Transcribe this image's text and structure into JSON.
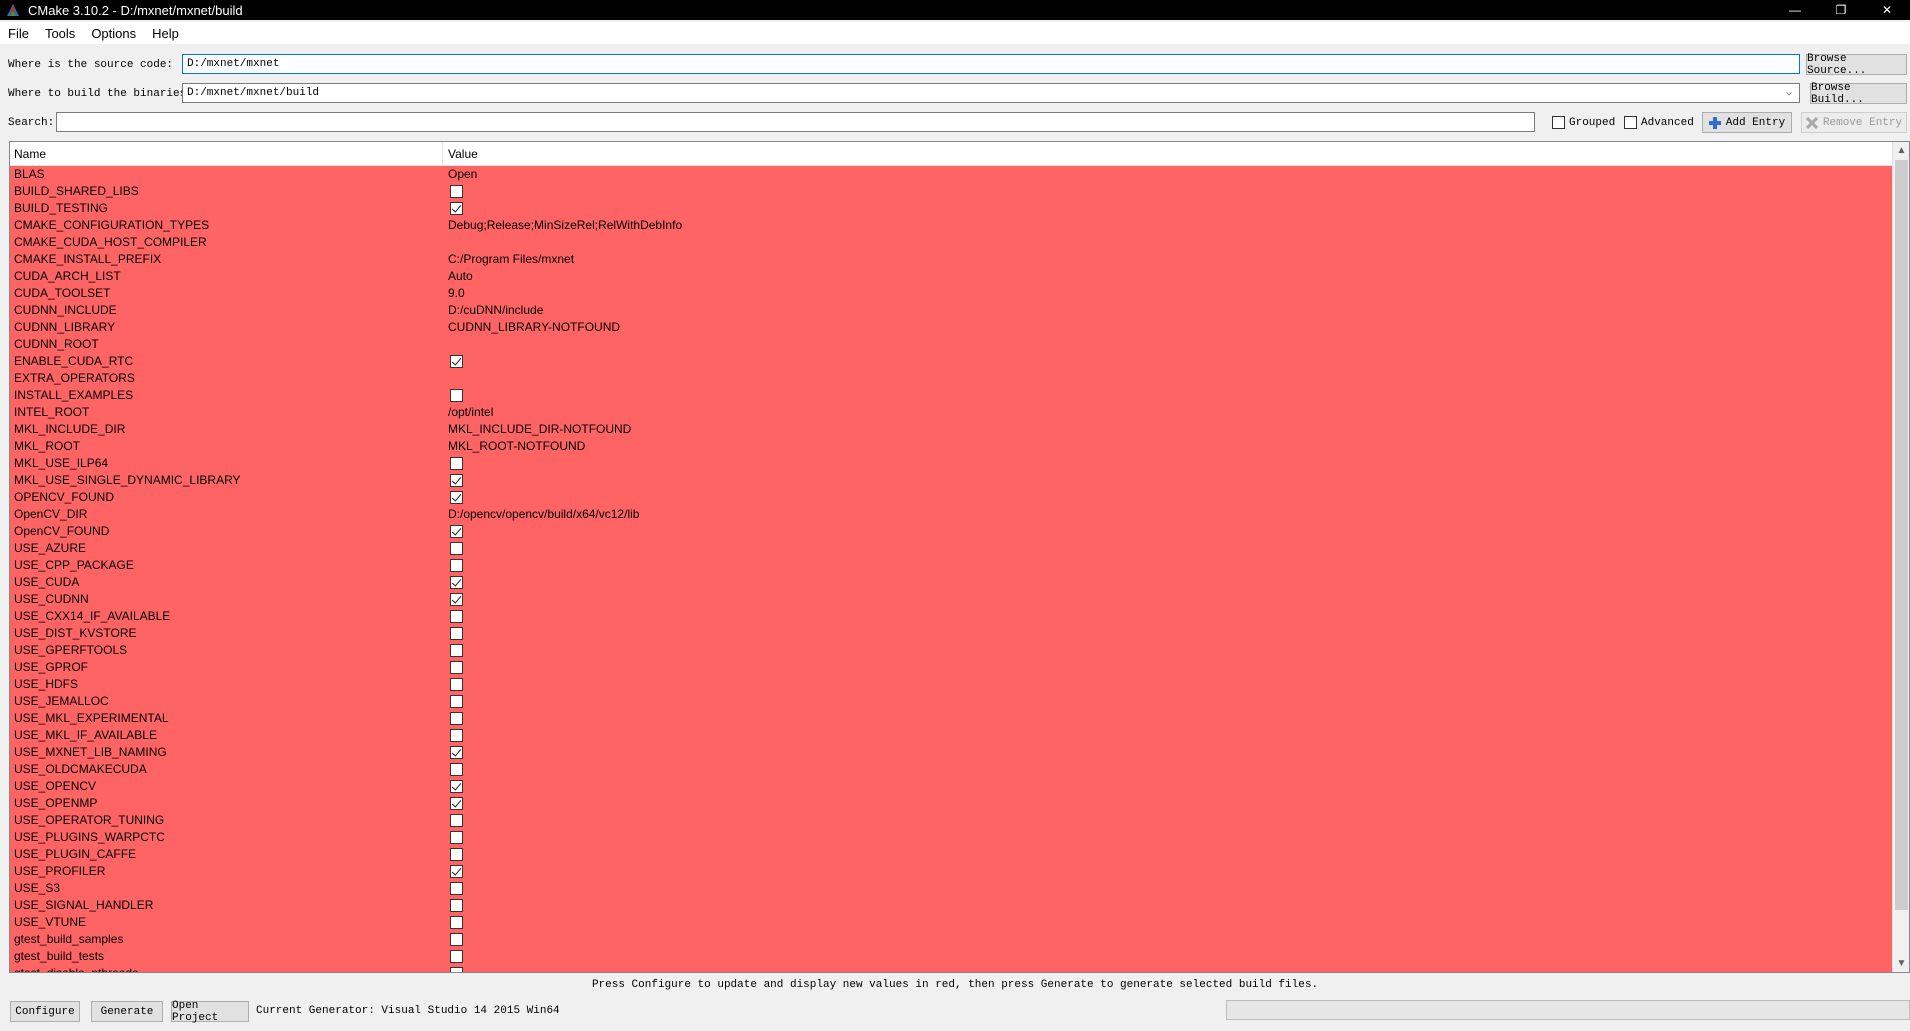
{
  "window": {
    "title": "CMake 3.10.2 - D:/mxnet/mxnet/build",
    "controls": {
      "minimize": "—",
      "restore": "❐",
      "close": "✕"
    }
  },
  "menu": [
    "File",
    "Tools",
    "Options",
    "Help"
  ],
  "source": {
    "label": "Where is the source code:",
    "value": "D:/mxnet/mxnet",
    "button": "Browse Source..."
  },
  "build": {
    "label": "Where to build the binaries:",
    "value": "D:/mxnet/mxnet/build",
    "button": "Browse Build..."
  },
  "search": {
    "label": "Search:",
    "value": "",
    "grouped": "Grouped",
    "advanced": "Advanced",
    "add_entry": "Add Entry",
    "remove_entry": "Remove Entry"
  },
  "table": {
    "headers": {
      "name": "Name",
      "value": "Value"
    },
    "row_color": "#ff6464",
    "rows": [
      {
        "name": "BLAS",
        "type": "text",
        "value": "Open"
      },
      {
        "name": "BUILD_SHARED_LIBS",
        "type": "bool",
        "checked": false
      },
      {
        "name": "BUILD_TESTING",
        "type": "bool",
        "checked": true
      },
      {
        "name": "CMAKE_CONFIGURATION_TYPES",
        "type": "text",
        "value": "Debug;Release;MinSizeRel;RelWithDebInfo"
      },
      {
        "name": "CMAKE_CUDA_HOST_COMPILER",
        "type": "text",
        "value": ""
      },
      {
        "name": "CMAKE_INSTALL_PREFIX",
        "type": "text",
        "value": "C:/Program Files/mxnet"
      },
      {
        "name": "CUDA_ARCH_LIST",
        "type": "text",
        "value": "Auto"
      },
      {
        "name": "CUDA_TOOLSET",
        "type": "text",
        "value": "9.0"
      },
      {
        "name": "CUDNN_INCLUDE",
        "type": "text",
        "value": "D:/cuDNN/include"
      },
      {
        "name": "CUDNN_LIBRARY",
        "type": "text",
        "value": "CUDNN_LIBRARY-NOTFOUND"
      },
      {
        "name": "CUDNN_ROOT",
        "type": "text",
        "value": ""
      },
      {
        "name": "ENABLE_CUDA_RTC",
        "type": "bool",
        "checked": true
      },
      {
        "name": "EXTRA_OPERATORS",
        "type": "text",
        "value": ""
      },
      {
        "name": "INSTALL_EXAMPLES",
        "type": "bool",
        "checked": false
      },
      {
        "name": "INTEL_ROOT",
        "type": "text",
        "value": "/opt/intel"
      },
      {
        "name": "MKL_INCLUDE_DIR",
        "type": "text",
        "value": "MKL_INCLUDE_DIR-NOTFOUND"
      },
      {
        "name": "MKL_ROOT",
        "type": "text",
        "value": "MKL_ROOT-NOTFOUND"
      },
      {
        "name": "MKL_USE_ILP64",
        "type": "bool",
        "checked": false
      },
      {
        "name": "MKL_USE_SINGLE_DYNAMIC_LIBRARY",
        "type": "bool",
        "checked": true
      },
      {
        "name": "OPENCV_FOUND",
        "type": "bool",
        "checked": true
      },
      {
        "name": "OpenCV_DIR",
        "type": "text",
        "value": "D:/opencv/opencv/build/x64/vc12/lib"
      },
      {
        "name": "OpenCV_FOUND",
        "type": "bool",
        "checked": true
      },
      {
        "name": "USE_AZURE",
        "type": "bool",
        "checked": false
      },
      {
        "name": "USE_CPP_PACKAGE",
        "type": "bool",
        "checked": false
      },
      {
        "name": "USE_CUDA",
        "type": "bool",
        "checked": true
      },
      {
        "name": "USE_CUDNN",
        "type": "bool",
        "checked": true
      },
      {
        "name": "USE_CXX14_IF_AVAILABLE",
        "type": "bool",
        "checked": false
      },
      {
        "name": "USE_DIST_KVSTORE",
        "type": "bool",
        "checked": false
      },
      {
        "name": "USE_GPERFTOOLS",
        "type": "bool",
        "checked": false
      },
      {
        "name": "USE_GPROF",
        "type": "bool",
        "checked": false
      },
      {
        "name": "USE_HDFS",
        "type": "bool",
        "checked": false
      },
      {
        "name": "USE_JEMALLOC",
        "type": "bool",
        "checked": false
      },
      {
        "name": "USE_MKL_EXPERIMENTAL",
        "type": "bool",
        "checked": false
      },
      {
        "name": "USE_MKL_IF_AVAILABLE",
        "type": "bool",
        "checked": false
      },
      {
        "name": "USE_MXNET_LIB_NAMING",
        "type": "bool",
        "checked": true
      },
      {
        "name": "USE_OLDCMAKECUDA",
        "type": "bool",
        "checked": false
      },
      {
        "name": "USE_OPENCV",
        "type": "bool",
        "checked": true
      },
      {
        "name": "USE_OPENMP",
        "type": "bool",
        "checked": true
      },
      {
        "name": "USE_OPERATOR_TUNING",
        "type": "bool",
        "checked": false
      },
      {
        "name": "USE_PLUGINS_WARPCTC",
        "type": "bool",
        "checked": false
      },
      {
        "name": "USE_PLUGIN_CAFFE",
        "type": "bool",
        "checked": false
      },
      {
        "name": "USE_PROFILER",
        "type": "bool",
        "checked": true
      },
      {
        "name": "USE_S3",
        "type": "bool",
        "checked": false
      },
      {
        "name": "USE_SIGNAL_HANDLER",
        "type": "bool",
        "checked": false
      },
      {
        "name": "USE_VTUNE",
        "type": "bool",
        "checked": false
      },
      {
        "name": "gtest_build_samples",
        "type": "bool",
        "checked": false
      },
      {
        "name": "gtest_build_tests",
        "type": "bool",
        "checked": false
      },
      {
        "name": "gtest_disable_pthreads",
        "type": "bool",
        "checked": false
      }
    ]
  },
  "status_message": "Press Configure to update and display new values in red, then press Generate to generate selected build files.",
  "buttons": {
    "configure": "Configure",
    "generate": "Generate",
    "open_project": "Open Project"
  },
  "generator": "Current Generator: Visual Studio 14 2015 Win64"
}
